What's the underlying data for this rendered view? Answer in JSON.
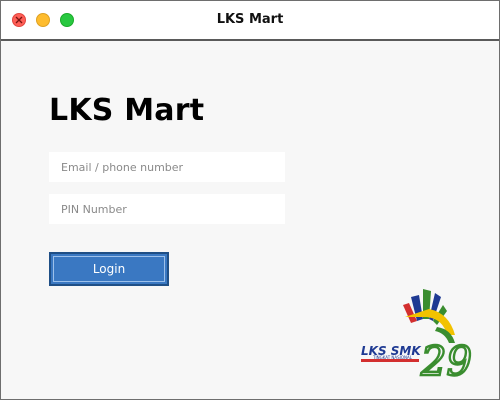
{
  "window": {
    "title": "LKS Mart"
  },
  "login": {
    "heading": "LKS Mart",
    "email_placeholder": "Email / phone number",
    "email_value": "",
    "pin_placeholder": "PIN Number",
    "pin_value": "",
    "button_label": "Login"
  },
  "logo": {
    "name": "lks-smk-29-logo",
    "text_main": "LKS SMK",
    "text_sub": "TINGKAT NASIONAL",
    "number": "29"
  },
  "colors": {
    "close": "#ff5f57",
    "minimize": "#febc2e",
    "maximize": "#28c840",
    "button": "#3a78c2",
    "button_border": "#1f4f86",
    "logo_blue": "#1f3a93",
    "logo_red": "#d32f2f",
    "logo_green": "#3a8d2f",
    "logo_yellow": "#f2c200"
  }
}
